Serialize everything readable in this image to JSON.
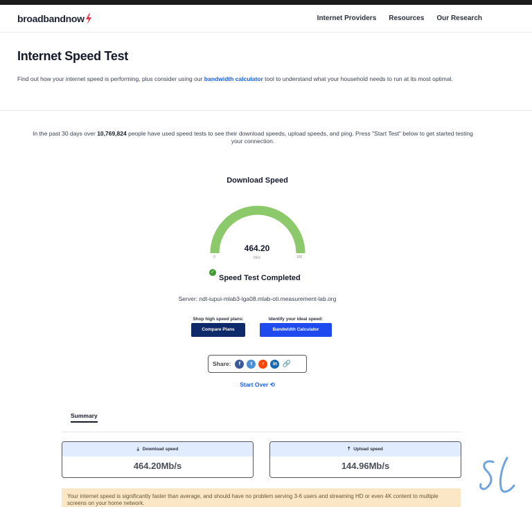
{
  "header": {
    "logo_text": "broadbandnow",
    "nav": [
      "Internet Providers",
      "Resources",
      "Our Research"
    ]
  },
  "hero": {
    "title": "Internet Speed Test",
    "intro_before": "Find out how your internet speed is performing, plus consider using our ",
    "intro_link": "bandwidth calculator",
    "intro_after": " tool to understand what your household needs to run at its most optimal."
  },
  "stats": {
    "before": "In the past 30 days over ",
    "count": "10,769,824",
    "after": " people have used speed tests to see their download speeds, upload speeds, and ping. Press \"Start Test\" below to get started testing your connection."
  },
  "gauge": {
    "title": "Download Speed",
    "value": "464.20",
    "unit": "Mb/s",
    "min": "0",
    "max": "100",
    "fill_fraction": 1.0,
    "color": "#8cc96b"
  },
  "status": {
    "text": "Speed Test Completed",
    "check_icon": "check-circle-icon"
  },
  "server": "Server: ndt-iupui-mlab3-lga08.mlab-oti.measurement-lab.org",
  "cta": {
    "plans_label": "Shop high speed plans:",
    "plans_button": "Compare Plans",
    "speed_label": "Identify your ideal speed:",
    "speed_button": "Bandwidth Calculator"
  },
  "share": {
    "label": "Share:",
    "icons": [
      "facebook-icon",
      "twitter-icon",
      "reddit-icon",
      "linkedin-icon",
      "link-icon"
    ]
  },
  "start_over": "Start Over",
  "summary": {
    "tab": "Summary",
    "download_label": "Download speed",
    "download_value": "464.20Mb/s",
    "upload_label": "Upload speed",
    "upload_value": "144.96Mb/s"
  },
  "notice": "Your internet speed is significantly faster than average, and should have no problem serving 3-6 users and streaming HD or even 4K content to multiple screens on your home network.",
  "colors": {
    "brand_blue": "#1760e8",
    "dark_navy": "#0e2a6b",
    "bright_blue": "#1f4af0",
    "notice_bg": "#fbe6c6",
    "bolt": "#e8344e"
  }
}
